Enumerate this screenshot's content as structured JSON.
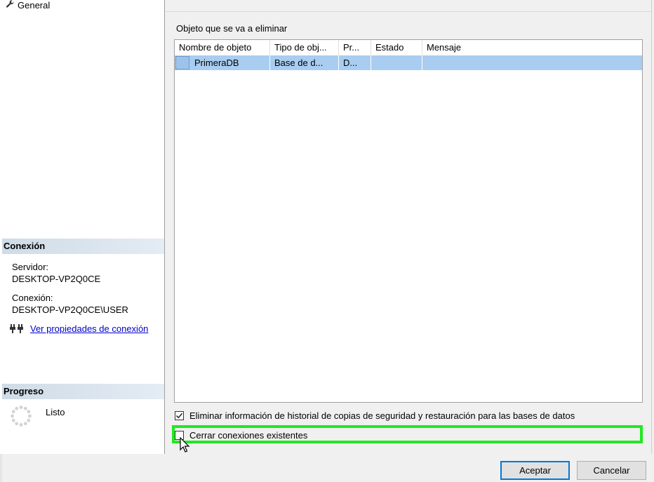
{
  "sidebar": {
    "nav_items": [
      {
        "label": "General",
        "icon": "wrench-icon"
      }
    ],
    "connection": {
      "header": "Conexión",
      "server_label": "Servidor:",
      "server_value": "DESKTOP-VP2Q0CE",
      "connection_label": "Conexión:",
      "connection_value": "DESKTOP-VP2Q0CE\\USER",
      "link_label": "Ver propiedades de conexión"
    },
    "progress": {
      "header": "Progreso",
      "status": "Listo"
    }
  },
  "main": {
    "objects_label": "Objeto que se va a eliminar",
    "columns": [
      "Nombre de objeto",
      "Tipo de obj...",
      "Pr...",
      "Estado",
      "Mensaje"
    ],
    "rows": [
      {
        "name": "PrimeraDB",
        "type": "Base de d...",
        "pr": "D...",
        "estado": "",
        "mensaje": ""
      }
    ],
    "options": [
      {
        "label": "Eliminar información de historial de copias de seguridad y restauración para las bases de datos",
        "checked": true
      },
      {
        "label": "Cerrar conexiones existentes",
        "checked": false
      }
    ]
  },
  "footer": {
    "accept_label": "Aceptar",
    "cancel_label": "Cancelar"
  },
  "colors": {
    "selection": "#a8cdf0",
    "highlight_box": "#22e822",
    "section_header": "#cfdbe7",
    "link": "#0000cc",
    "primary_button_border": "#0078d7"
  }
}
